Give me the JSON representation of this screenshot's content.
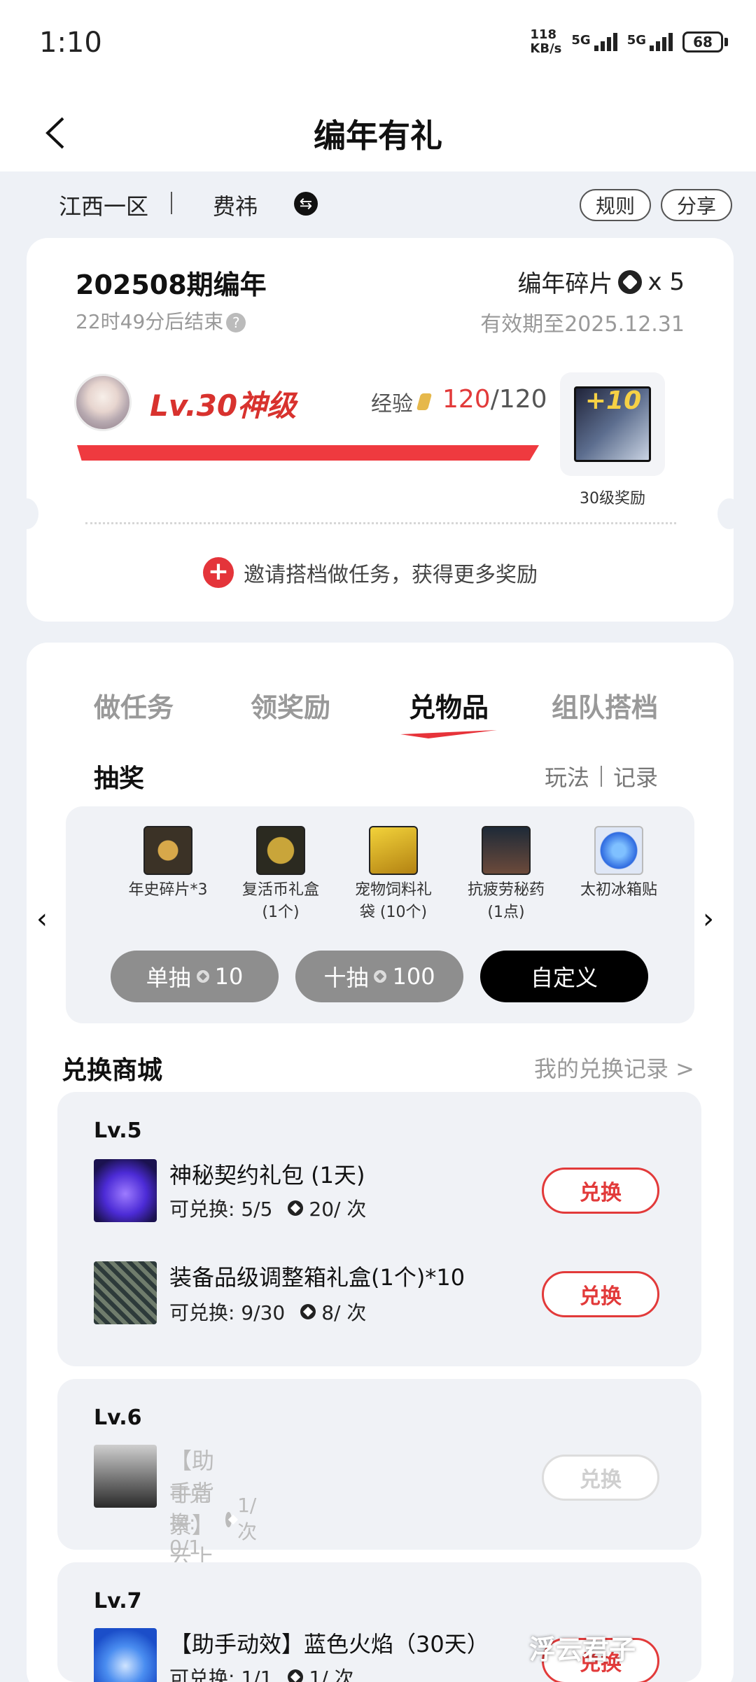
{
  "status_bar": {
    "time": "1:10",
    "net_speed_value": "118",
    "net_speed_unit": "KB/s",
    "sig1_label": "5G",
    "sig2_label": "5G",
    "battery": "68"
  },
  "header": {
    "title": "编年有礼"
  },
  "account": {
    "region": "江西一区",
    "name": "费祎",
    "rules_label": "规则",
    "share_label": "分享"
  },
  "season": {
    "period": "202508期编年",
    "countdown": "22时49分后结束",
    "fragments_label": "编年碎片",
    "fragments_count": "x 5",
    "valid_until": "有效期至2025.12.31",
    "level": "Lv.30神级",
    "exp_label": "经验",
    "exp_current": "120",
    "exp_total": "/120",
    "exp_progress": 1.0,
    "reward_badge": "+10",
    "reward_label": "30级奖励",
    "invite_text": "邀请搭档做任务，获得更多奖励"
  },
  "tabs": [
    {
      "label": "做任务",
      "active": false
    },
    {
      "label": "领奖励",
      "active": false
    },
    {
      "label": "兑物品",
      "active": true
    },
    {
      "label": "组队搭档",
      "active": false
    }
  ],
  "lottery": {
    "title": "抽奖",
    "link_rules": "玩法",
    "link_records": "记录",
    "prizes": [
      {
        "label": "年史碎片*3",
        "color": "#3b3226",
        "icon": "fragment-prize-icon"
      },
      {
        "label": "复活币礼盒\n(1个)",
        "color": "#2b2a20",
        "icon": "revive-coin-icon"
      },
      {
        "label": "宠物饲料礼\n袋 (10个)",
        "color": "#c7a21b",
        "icon": "pet-food-icon"
      },
      {
        "label": "抗疲劳秘药\n(1点)",
        "color": "#2c3c4f",
        "icon": "potion-icon"
      },
      {
        "label": "太初冰箱贴",
        "color": "#2e6ae0",
        "icon": "fridge-magnet-icon"
      }
    ],
    "single_label": "单抽",
    "single_cost": "10",
    "ten_label": "十抽",
    "ten_cost": "100",
    "custom_label": "自定义"
  },
  "shop": {
    "title": "兑换商城",
    "records_link": "我的兑换记录 >",
    "groups": [
      {
        "level": "Lv.5",
        "items": [
          {
            "name": "神秘契约礼包 (1天)",
            "avail": "可兑换: 5/5",
            "cost": "20/ 次",
            "button": "兑换",
            "enabled": true,
            "icon": "mystery-bag-icon"
          },
          {
            "name": "装备品级调整箱礼盒(1个)*10",
            "avail": "可兑换: 9/30",
            "cost": "8/ 次",
            "button": "兑换",
            "enabled": true,
            "icon": "equipment-box-icon"
          }
        ]
      },
      {
        "level": "Lv.6",
        "items": [
          {
            "name": "【助手背景】云上长安（30天）",
            "avail": "可兑换: 0/1",
            "cost": "1/ 次",
            "button": "兑换",
            "enabled": false,
            "icon": "background-image-icon"
          }
        ]
      },
      {
        "level": "Lv.7",
        "items": [
          {
            "name": "【助手动效】蓝色火焰（30天）",
            "avail": "可兑换: 1/1",
            "cost": "1/ 次",
            "button": "兑换",
            "enabled": true,
            "icon": "blue-flame-icon"
          }
        ]
      }
    ]
  },
  "watermark": "浮云君子",
  "colors": {
    "accent_red": "#e23a3a",
    "bar_red": "#ef3a3f",
    "background": "#eef1f6"
  }
}
